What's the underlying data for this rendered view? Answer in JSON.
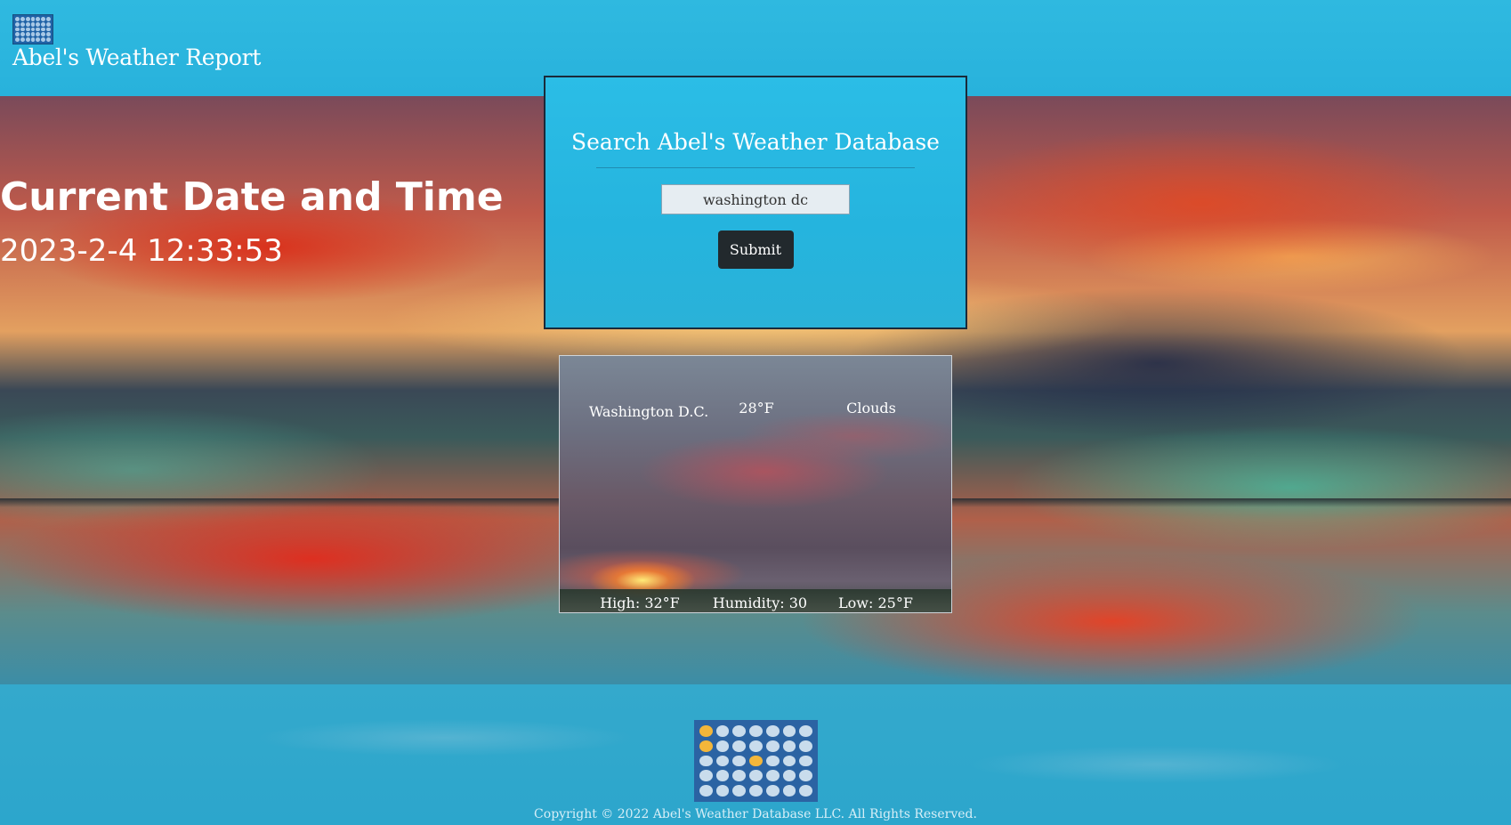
{
  "header": {
    "title": "Abel's Weather Report",
    "logo_icon": "weather-icons-grid-icon"
  },
  "datetime": {
    "title": "Current Date and Time",
    "value": "2023-2-4 12:33:53"
  },
  "search": {
    "title": "Search Abel's Weather Database",
    "input_value": "washington dc",
    "submit_label": "Submit"
  },
  "weather": {
    "city": "Washington D.C.",
    "temperature": "28°F",
    "condition": "Clouds",
    "high": "High: 32°F",
    "humidity": "Humidity: 30",
    "low": "Low: 25°F"
  },
  "footer": {
    "logo_icon": "weather-icons-grid-icon",
    "copyright": "Copyright © 2022 Abel's Weather Database LLC. All Rights Reserved."
  },
  "colors": {
    "header_bg": "#2fb9e0",
    "search_bg": "#2bbde6",
    "button_bg": "#22292d",
    "footer_bg": "#2ca6cc"
  }
}
